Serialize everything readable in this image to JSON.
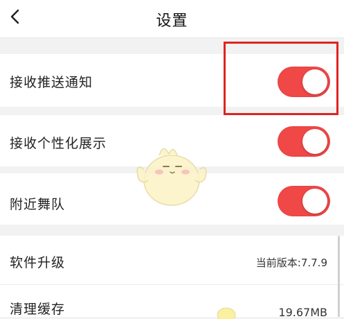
{
  "header": {
    "title": "设置"
  },
  "settings": {
    "push_notifications": {
      "label": "接收推送通知",
      "enabled": true
    },
    "personalized_display": {
      "label": "接收个性化展示",
      "enabled": true
    },
    "nearby_teams": {
      "label": "附近舞队",
      "enabled": true
    },
    "software_update": {
      "label": "软件升级",
      "value": "当前版本:7.7.9"
    },
    "clear_cache": {
      "label": "清理缓存",
      "value": "19.67MB"
    }
  },
  "colors": {
    "toggle_on": "#f04747",
    "highlight_box": "#e0231f",
    "background": "#f2f2f2"
  },
  "icons": {
    "back": "chevron-left-icon"
  }
}
